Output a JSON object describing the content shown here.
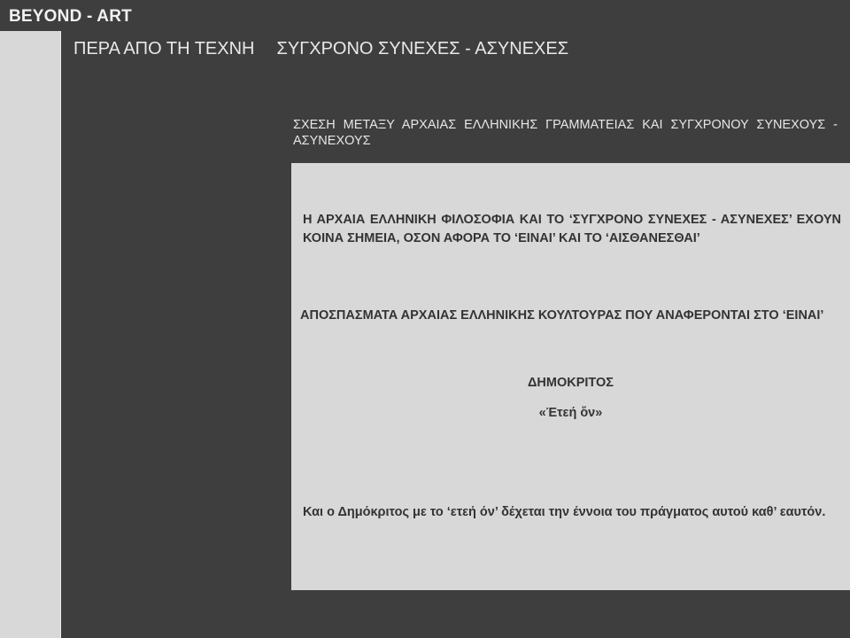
{
  "site": {
    "title": "BEYOND - ART"
  },
  "nav": {
    "items": [
      {
        "label": "ΠΕΡΑ ΑΠΟ ΤΗ ΤΕΧΝΗ"
      },
      {
        "label": "ΣΥΓΧΡΟΝΟ ΣΥΝΕΧΕΣ - ΑΣΥΝΕΧΕΣ"
      }
    ]
  },
  "section": {
    "heading": "ΣΧΕΣΗ ΜΕΤΑΞΥ ΑΡΧΑΙΑΣ ΕΛΛΗΝΙΚΗΣ ΓΡΑΜΜΑΤΕΙΑΣ ΚΑΙ ΣΥΓΧΡΟΝΟΥ ΣΥΝΕΧΟΥΣ - ΑΣΥΝΕΧΟΥΣ"
  },
  "content": {
    "intro": "Η ΑΡΧΑΙΑ ΕΛΛΗΝΙΚΗ ΦΙΛΟΣΟΦΙΑ ΚΑΙ ΤΟ ‘ΣΥΓΧΡΟΝΟ ΣΥΝΕΧΕΣ - ΑΣΥΝΕΧΕΣ’ ΕΧΟΥΝ ΚΟΙΝΑ ΣΗΜΕΙΑ, ΟΣΟΝ ΑΦΟΡΑ ΤΟ ‘ΕΙΝΑΙ’ ΚΑΙ ΤΟ ‘ΑΙΣΘΑΝΕΣΘΑΙ’",
    "excerpts_heading": "ΑΠΟΣΠΑΣΜΑΤΑ ΑΡΧΑΙΑΣ ΕΛΛΗΝΙΚΗΣ ΚΟΥΛΤΟΥΡΑΣ ΠΟΥ ΑΝΑΦΕΡΟΝΤΑΙ ΣΤΟ ‘ΕΙΝΑΙ’",
    "philosopher": "ΔΗΜΟΚΡΙΤΟΣ",
    "quote": "«Έτεή ὄν»",
    "explanation": "Και ο Δημόκριτος με το ‘ετεή όν’ δέχεται την έννοια του πράγματος αυτού καθ’ εαυτόν."
  }
}
